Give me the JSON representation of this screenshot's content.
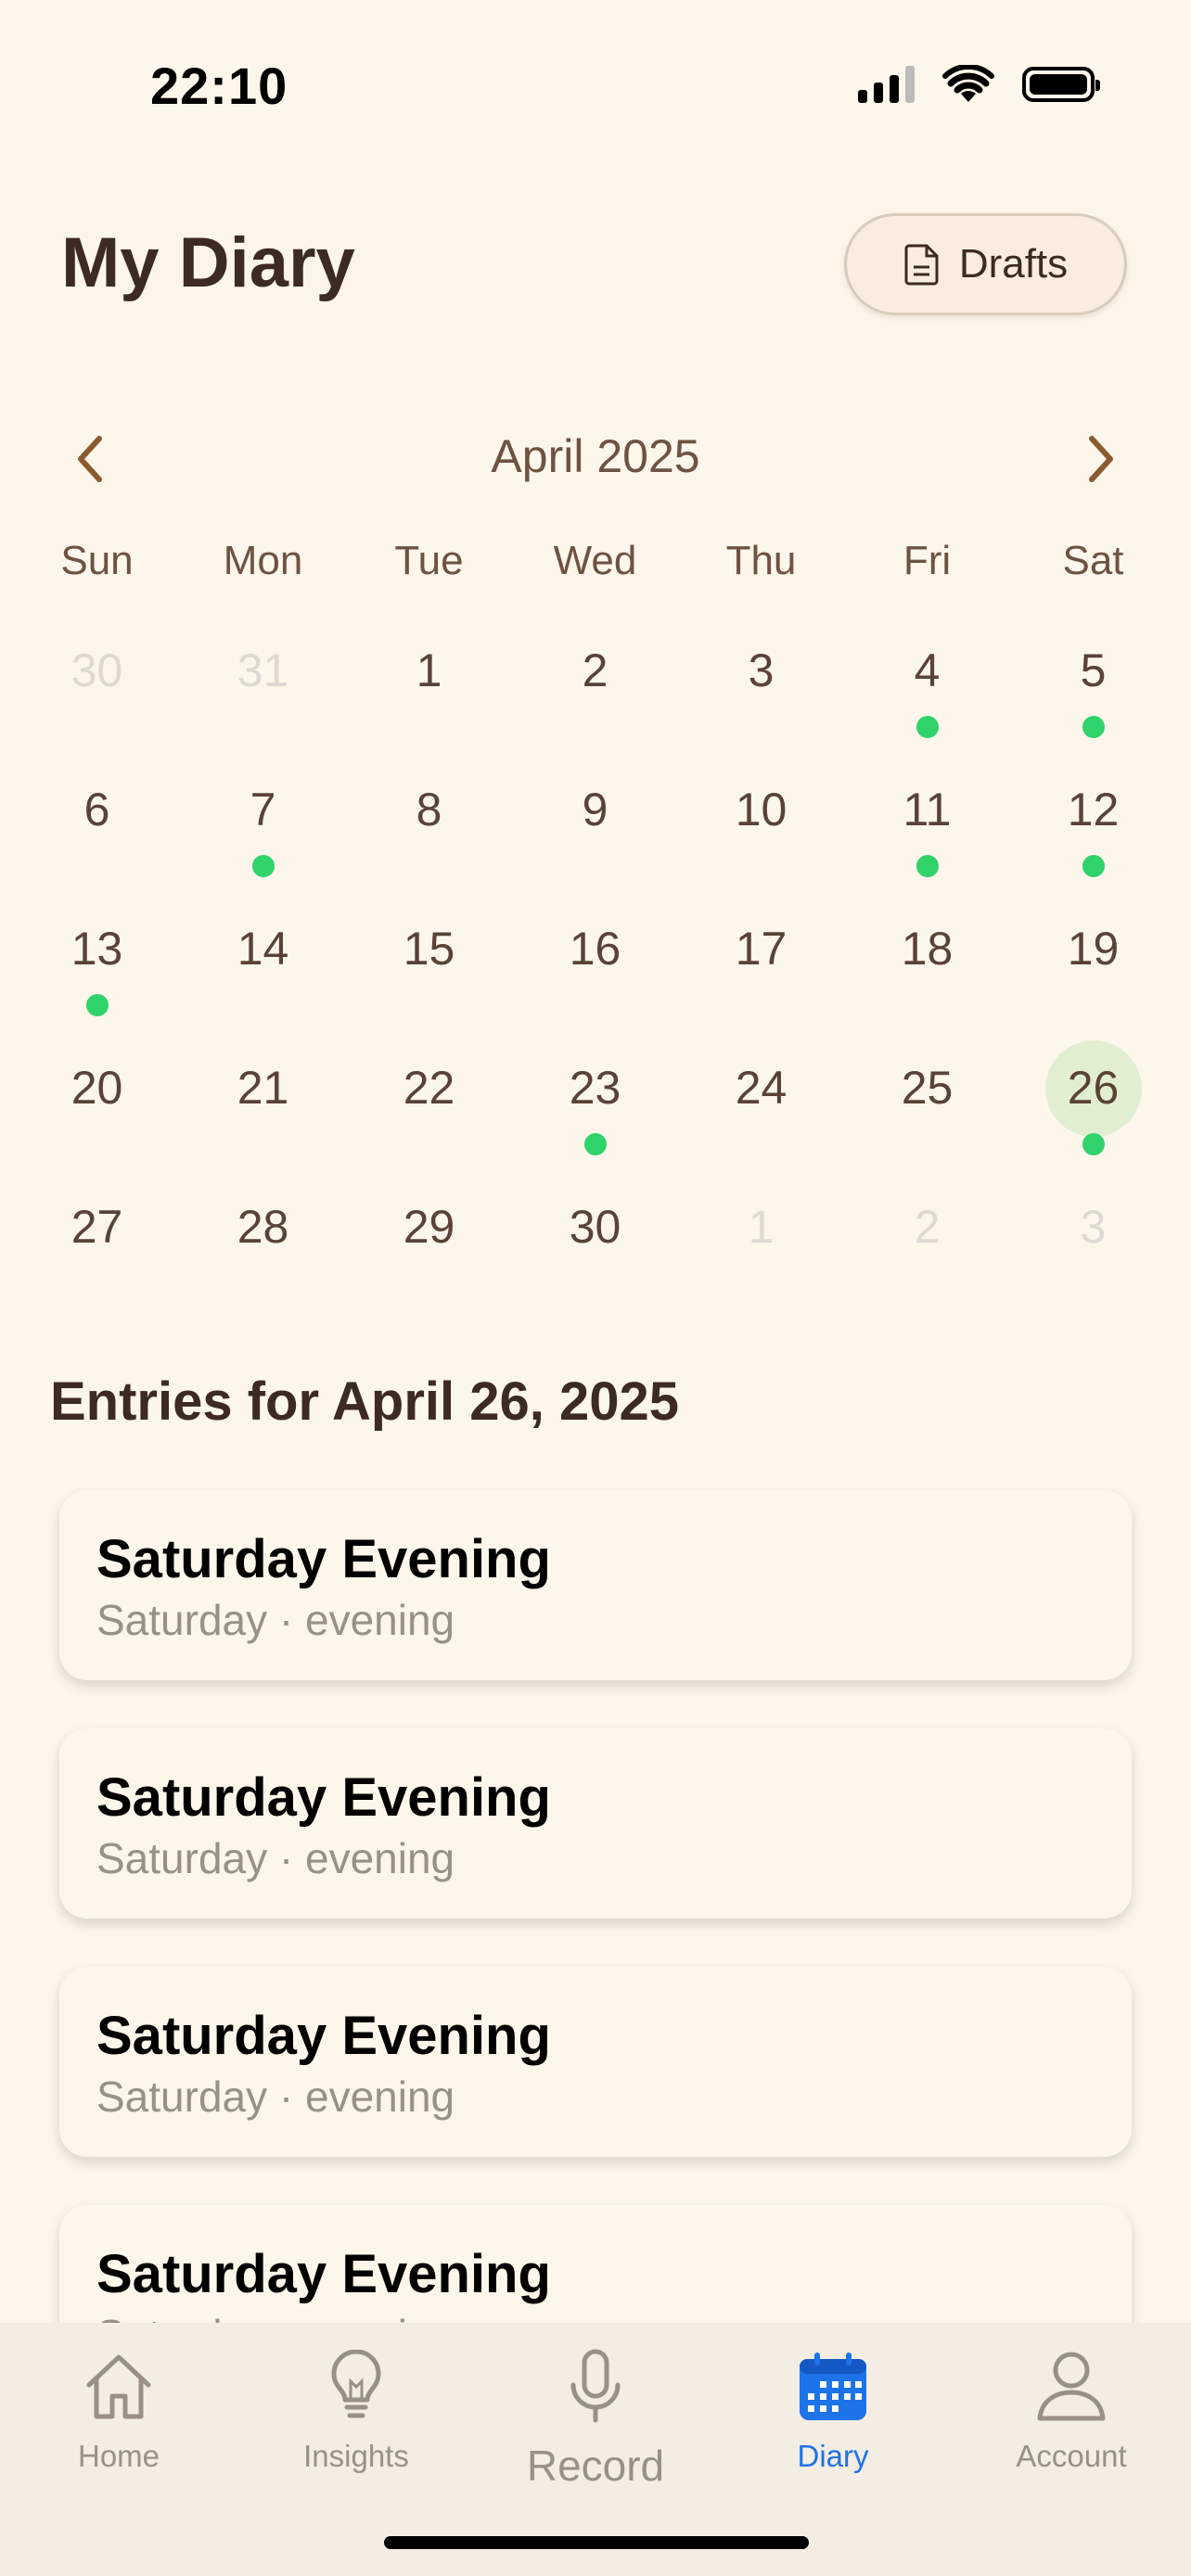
{
  "status_bar": {
    "time": "22:10"
  },
  "header": {
    "title": "My Diary",
    "drafts_label": "Drafts"
  },
  "calendar": {
    "month_label": "April 2025",
    "weekdays": [
      "Sun",
      "Mon",
      "Tue",
      "Wed",
      "Thu",
      "Fri",
      "Sat"
    ],
    "days": [
      {
        "day": "30",
        "muted": true,
        "entry": false
      },
      {
        "day": "31",
        "muted": true,
        "entry": false
      },
      {
        "day": "1",
        "muted": false,
        "entry": false
      },
      {
        "day": "2",
        "muted": false,
        "entry": false
      },
      {
        "day": "3",
        "muted": false,
        "entry": false
      },
      {
        "day": "4",
        "muted": false,
        "entry": true
      },
      {
        "day": "5",
        "muted": false,
        "entry": true
      },
      {
        "day": "6",
        "muted": false,
        "entry": false
      },
      {
        "day": "7",
        "muted": false,
        "entry": true
      },
      {
        "day": "8",
        "muted": false,
        "entry": false
      },
      {
        "day": "9",
        "muted": false,
        "entry": false
      },
      {
        "day": "10",
        "muted": false,
        "entry": false
      },
      {
        "day": "11",
        "muted": false,
        "entry": true
      },
      {
        "day": "12",
        "muted": false,
        "entry": true
      },
      {
        "day": "13",
        "muted": false,
        "entry": true
      },
      {
        "day": "14",
        "muted": false,
        "entry": false
      },
      {
        "day": "15",
        "muted": false,
        "entry": false
      },
      {
        "day": "16",
        "muted": false,
        "entry": false
      },
      {
        "day": "17",
        "muted": false,
        "entry": false
      },
      {
        "day": "18",
        "muted": false,
        "entry": false
      },
      {
        "day": "19",
        "muted": false,
        "entry": false
      },
      {
        "day": "20",
        "muted": false,
        "entry": false
      },
      {
        "day": "21",
        "muted": false,
        "entry": false
      },
      {
        "day": "22",
        "muted": false,
        "entry": false
      },
      {
        "day": "23",
        "muted": false,
        "entry": true
      },
      {
        "day": "24",
        "muted": false,
        "entry": false
      },
      {
        "day": "25",
        "muted": false,
        "entry": false
      },
      {
        "day": "26",
        "muted": false,
        "entry": true,
        "selected": true
      },
      {
        "day": "27",
        "muted": false,
        "entry": false
      },
      {
        "day": "28",
        "muted": false,
        "entry": false
      },
      {
        "day": "29",
        "muted": false,
        "entry": false
      },
      {
        "day": "30",
        "muted": false,
        "entry": false
      },
      {
        "day": "1",
        "muted": true,
        "entry": false
      },
      {
        "day": "2",
        "muted": true,
        "entry": false
      },
      {
        "day": "3",
        "muted": true,
        "entry": false
      }
    ]
  },
  "entries": {
    "heading": "Entries for April 26, 2025",
    "items": [
      {
        "title": "Saturday Evening",
        "subtitle": "Saturday · evening"
      },
      {
        "title": "Saturday Evening",
        "subtitle": "Saturday · evening"
      },
      {
        "title": "Saturday Evening",
        "subtitle": "Saturday · evening"
      },
      {
        "title": "Saturday Evening",
        "subtitle": "Saturday · evening"
      }
    ]
  },
  "tab_bar": {
    "tabs": [
      {
        "label": "Home",
        "icon": "house-icon",
        "active": false
      },
      {
        "label": "Insights",
        "icon": "lightbulb-icon",
        "active": false
      },
      {
        "label": "Record",
        "icon": "microphone-icon",
        "active": false
      },
      {
        "label": "Diary",
        "icon": "calendar-icon",
        "active": true
      },
      {
        "label": "Account",
        "icon": "person-icon",
        "active": false
      }
    ]
  },
  "colors": {
    "accent": "#1d73e8",
    "entry_dot": "#2fd36a",
    "selected_halo": "#e1eed2",
    "background": "#fdf6ea"
  }
}
